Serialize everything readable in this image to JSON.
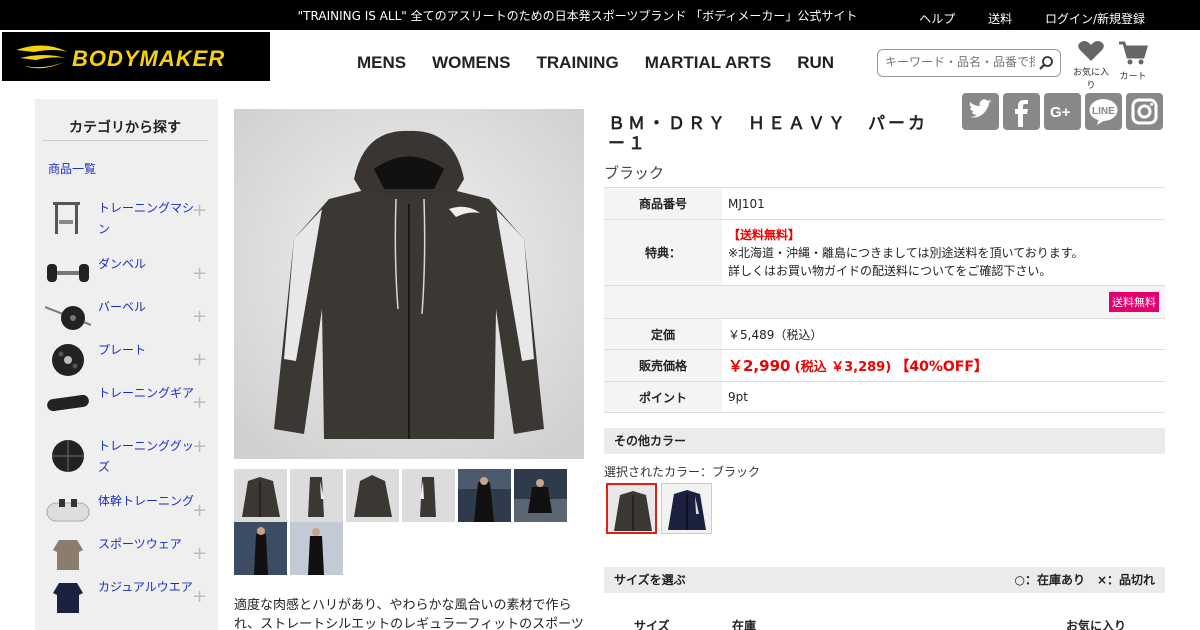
{
  "topbar": {
    "message": "\"TRAINING IS ALL\" 全てのアスリートのための日本発スポーツブランド 「ボディメーカー」公式サイト",
    "links": [
      "ヘルプ",
      "送料",
      "ログイン/新規登録"
    ]
  },
  "header": {
    "logo_text": "BODYMAKER",
    "nav": [
      "MENS",
      "WOMENS",
      "TRAINING",
      "MARTIAL ARTS",
      "RUN"
    ],
    "search_placeholder": "キーワード・品名・品番で探す",
    "favorites_label": "お気に入り",
    "cart_label": "カート"
  },
  "sidebar": {
    "title": "カテゴリから探す",
    "all_products": "商品一覧",
    "categories": [
      {
        "label": "トレーニングマシン",
        "icon": "machine-icon"
      },
      {
        "label": "ダンベル",
        "icon": "dumbbell-icon"
      },
      {
        "label": "バーベル",
        "icon": "barbell-icon"
      },
      {
        "label": "プレート",
        "icon": "plate-icon"
      },
      {
        "label": "トレーニングギア",
        "icon": "gear-pad-icon"
      },
      {
        "label": "トレーニンググッズ",
        "icon": "ball-icon"
      },
      {
        "label": "体幹トレーニング",
        "icon": "core-bag-icon"
      },
      {
        "label": "スポーツウェア",
        "icon": "sportswear-icon"
      },
      {
        "label": "カジュアルウエア",
        "icon": "casual-wear-icon"
      }
    ],
    "plus": "+"
  },
  "product": {
    "title": "ＢＭ・ＤＲＹ　ＨＥＡＶＹ　パーカー１",
    "color_name": "ブラック",
    "specs": {
      "item_no_label": "商品番号",
      "item_no": "MJ101",
      "benefit_label": "特典：",
      "benefit_title": "【送料無料】",
      "benefit_line1": "※北海道・沖縄・離島につきましては別途送料を頂いております。",
      "benefit_line2": "詳しくはお買い物ガイドの配送料についてをご確認下さい。",
      "free_shipping_badge": "送料無料",
      "list_price_label": "定価",
      "list_price": "￥5,489（税込）",
      "sale_price_label": "販売価格",
      "sale_price": "￥2,990",
      "sale_price_tax": "(税込 ￥3,289)",
      "discount": "【40%OFF】",
      "point_label": "ポイント",
      "point": "9pt"
    },
    "other_colors_heading": "その他カラー",
    "selected_color_text": "選択されたカラー：ブラック",
    "size_heading": "サイズを選ぶ",
    "stock_legend": "○：在庫あり　×：品切れ",
    "size_columns": [
      "サイズ",
      "在庫",
      "お気に入り"
    ],
    "description": "適度な肉感とハリがあり、やわらかな風合いの素材で作られ、ストレートシルエットのレギュラーフィットのスポーツパーカで"
  },
  "social": [
    "twitter-icon",
    "facebook-icon",
    "google-plus-icon",
    "line-icon",
    "instagram-icon"
  ],
  "colors": {
    "accent_red": "#ee0000",
    "badge_pink": "#e4006f",
    "logo_yellow": "#f5d20a",
    "link_blue": "#1a2fc1"
  }
}
